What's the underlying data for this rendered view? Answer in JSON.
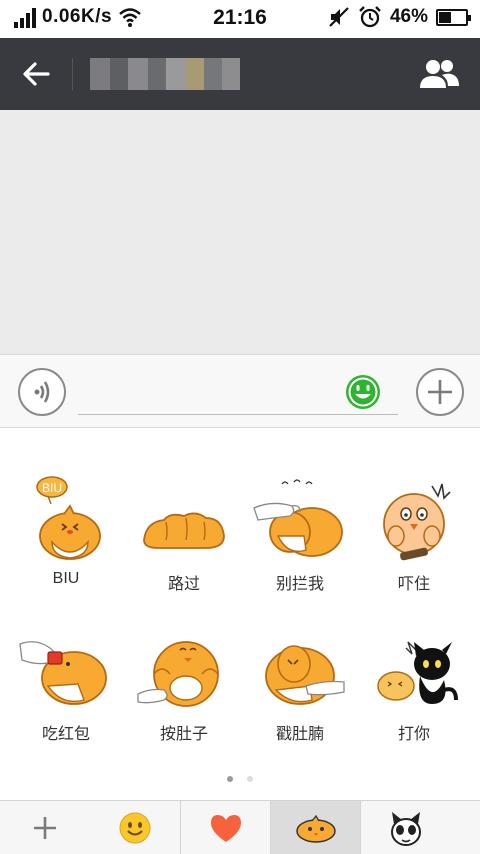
{
  "status_bar": {
    "net_speed": "0.06K/s",
    "time": "21:16",
    "battery": "46%",
    "battery_level": 0.46,
    "icons": [
      "signal-icon",
      "wifi-icon",
      "mute-icon",
      "alarm-icon",
      "battery-icon"
    ]
  },
  "header": {
    "back_icon": "arrow-left-icon",
    "members_icon": "group-icon",
    "title_pixelated": true,
    "bg_color": "#393a3f"
  },
  "input_bar": {
    "voice_icon": "voice-icon",
    "emoji_icon": "smiley-icon",
    "more_icon": "plus-icon",
    "text_value": "",
    "accent_color": "#2fb42f"
  },
  "stickers": [
    {
      "label": "BIU",
      "bubble": "BIU"
    },
    {
      "label": "路过"
    },
    {
      "label": "别拦我"
    },
    {
      "label": "吓住"
    },
    {
      "label": "吃红包"
    },
    {
      "label": "按肚子"
    },
    {
      "label": "戳肚腩"
    },
    {
      "label": "打你"
    }
  ],
  "pager": {
    "current_page": 1,
    "total_pages": 2
  },
  "tabbar": {
    "tabs": [
      {
        "icon": "plus-icon"
      },
      {
        "icon": "smiley-icon"
      },
      {
        "icon": "heart-icon"
      },
      {
        "icon": "chick-sticker-icon",
        "selected": true
      },
      {
        "icon": "cat-sticker-icon"
      }
    ]
  }
}
